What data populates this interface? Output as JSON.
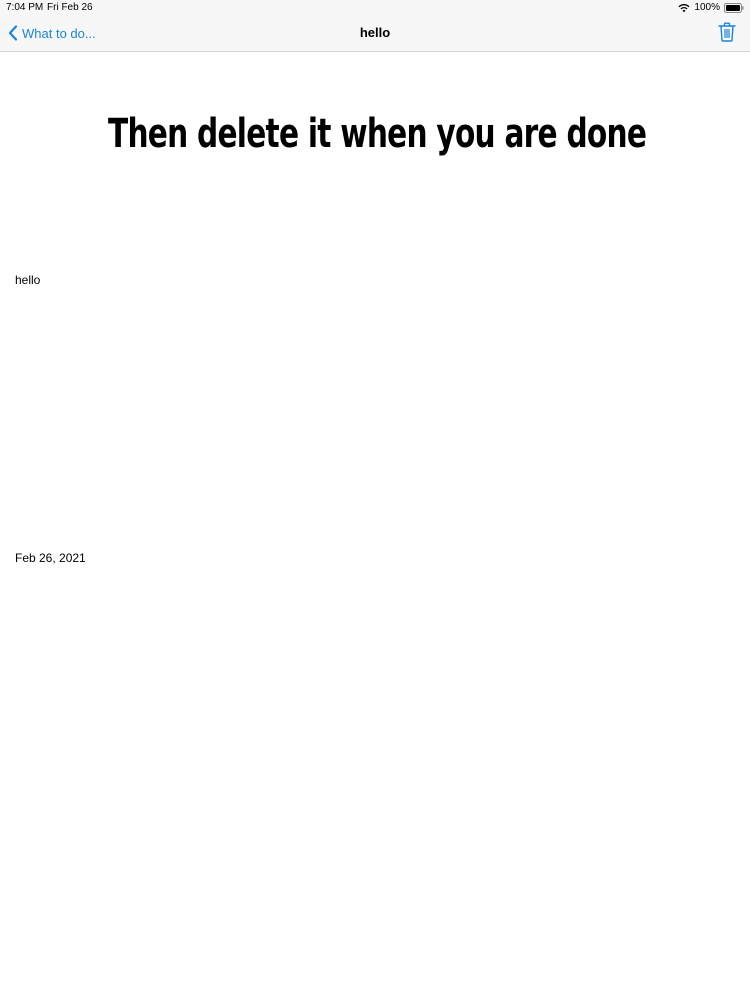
{
  "status_bar": {
    "time": "7:04 PM",
    "date": "Fri Feb 26",
    "battery": "100%"
  },
  "nav": {
    "back_label": "What to do...",
    "title": "hello",
    "accent_color": "#1a84d8",
    "back_icon": "chevron-left-icon",
    "action_icon": "trash-icon"
  },
  "content": {
    "headline": "Then delete it when you are done",
    "body": "hello",
    "date": "Feb 26, 2021"
  }
}
